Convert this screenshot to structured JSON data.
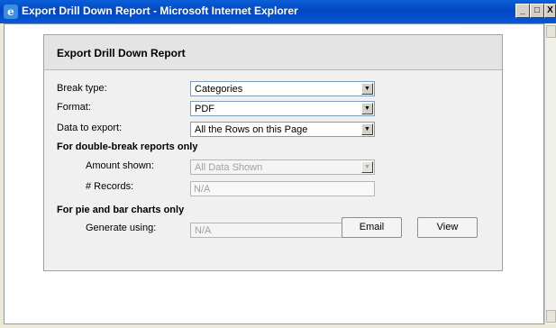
{
  "window": {
    "title": "Export Drill Down Report - Microsoft Internet Explorer",
    "minimize": "_",
    "maximize": "□",
    "close": "X"
  },
  "panel": {
    "title": "Export Drill Down Report",
    "break_type": {
      "label": "Break type:",
      "value": "Categories"
    },
    "format": {
      "label": "Format:",
      "value": "PDF"
    },
    "data_to_export": {
      "label": "Data to export:",
      "value": "All the Rows on this Page"
    },
    "double_break_section": "For double-break reports only",
    "amount_shown": {
      "label": "Amount shown:",
      "value": "All Data Shown"
    },
    "records": {
      "label": "# Records:",
      "value": "N/A"
    },
    "pie_bar_section": "For pie and bar charts only",
    "generate_using": {
      "label": "Generate using:",
      "value": "N/A"
    },
    "email_label": "Email",
    "view_label": "View"
  },
  "icons": {
    "dropdown_arrow": "▼",
    "ie_logo": "e"
  }
}
